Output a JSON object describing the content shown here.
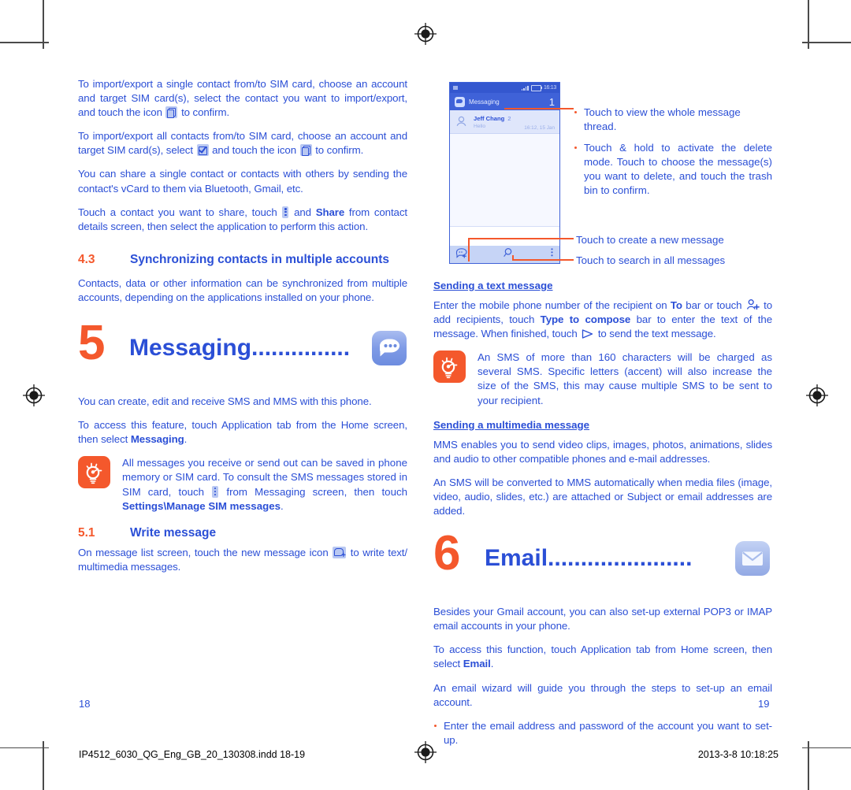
{
  "document": {
    "left_page_number": "18",
    "right_page_number": "19",
    "footer_file": "IP4512_6030_QG_Eng_GB_20_130308.indd   18-19",
    "footer_timestamp": "2013-3-8   10:18:25"
  },
  "left_column": {
    "paragraphs": [
      {
        "id": "p1",
        "pre": "To import/export a single contact from/to SIM card, choose an account and target SIM card(s), select the contact you want to import/export, and touch the icon ",
        "icon": "copy-icon",
        "post": " to confirm."
      },
      {
        "id": "p2",
        "pre": "To import/export all contacts from/to SIM card, choose an account and target SIM card(s), select ",
        "icon": "select-all-checkbox-icon",
        "mid": " and touch the icon ",
        "icon2": "copy-icon",
        "post": " to confirm."
      },
      {
        "id": "p3",
        "text": "You can share a single contact or contacts with others by sending the contact's vCard to them via Bluetooth, Gmail, etc."
      },
      {
        "id": "p4",
        "pre": "Touch a contact you want to share, touch ",
        "icon": "overflow-menu-icon",
        "mid": " and ",
        "bold": "Share",
        "post": " from contact details screen, then select the application to perform this action."
      }
    ],
    "section_4_3": {
      "number": "4.3",
      "title": "Synchronizing contacts in multiple accounts",
      "body": "Contacts, data or other information can be synchronized from multiple accounts, depending on the applications installed on your phone."
    },
    "chapter_5": {
      "number": "5",
      "title": "Messaging",
      "dots": "...............",
      "icon": "messaging-app-icon"
    },
    "messaging_intro": [
      "You can create, edit and receive SMS and MMS with this phone."
    ],
    "messaging_access": {
      "pre": "To access this feature, touch Application tab from the Home screen, then select ",
      "bold": "Messaging",
      "post": "."
    },
    "tip_note": {
      "icon": "tip-bulb-icon",
      "pre": "All messages you receive or send out can be saved in phone memory or SIM card. To consult the SMS messages stored in SIM card, touch ",
      "icon_inline": "overflow-menu-icon",
      "mid": " from Messaging screen, then touch ",
      "bold": "Settings\\Manage SIM messages",
      "post": "."
    },
    "section_5_1": {
      "number": "5.1",
      "title": "Write message",
      "pre": "On message list screen, touch the new message icon ",
      "icon": "new-message-icon",
      "post": " to write text/ multimedia messages."
    }
  },
  "phone_mock": {
    "status_bar": {
      "signal_icon": "signal-bars-icon",
      "battery_icon": "battery-icon",
      "clock": "16:13"
    },
    "app_bar": {
      "app_icon": "messaging-app-icon",
      "title": "Messaging",
      "count": "1"
    },
    "thread": {
      "avatar_icon": "contact-avatar-icon",
      "name": "Jeff Chang",
      "unread_count": "2",
      "preview": "Hello",
      "timestamp": "16:12, 15 Jan"
    },
    "bottom_bar": {
      "new_message_icon": "new-message-icon",
      "search_icon": "search-icon",
      "overflow_icon": "overflow-menu-icon"
    }
  },
  "callouts": {
    "thread_bullets": [
      "Touch to view the whole message thread.",
      "Touch & hold to activate the delete mode. Touch to choose the message(s) you want to delete, and touch the trash bin to confirm."
    ],
    "new_message": "Touch to create a new message",
    "search": "Touch to search in all messages"
  },
  "right_column": {
    "sending_text": {
      "heading": "Sending a text message",
      "pre": "Enter the mobile phone number of the recipient on ",
      "bold1": "To",
      "mid1": " bar or touch ",
      "icon1": "add-recipient-icon",
      "mid2": " to add recipients, touch ",
      "bold2": "Type to compose",
      "mid3": " bar to enter the text of the message. When finished, touch ",
      "icon2": "send-icon",
      "post": " to send the text message."
    },
    "tip_note": {
      "icon": "tip-bulb-icon",
      "text": "An SMS of more than 160 characters will be charged as several SMS. Specific letters (accent) will also increase the size of the SMS, this may cause multiple SMS to be sent to your recipient."
    },
    "sending_mms": {
      "heading": "Sending a multimedia message",
      "paragraphs": [
        "MMS enables you to send video clips, images, photos, animations, slides and audio to other compatible phones and e-mail addresses.",
        "An SMS will be converted to MMS automatically when media files (image, video, audio, slides, etc.) are attached or Subject or email addresses are added."
      ]
    },
    "chapter_6": {
      "number": "6",
      "title": "Email",
      "dots": "......................",
      "icon": "email-app-icon"
    },
    "email_body": {
      "p1": "Besides your Gmail account, you can also set-up external POP3 or IMAP email accounts in your phone.",
      "p2_pre": "To access this function, touch Application tab from Home screen, then select ",
      "p2_bold": "Email",
      "p2_post": ".",
      "p3": "An email wizard will guide you through the steps to set-up an email account.",
      "bullet1": "Enter the email address and password of the account you want to set-up."
    }
  },
  "colors": {
    "text_blue": "#2b4fd6",
    "accent_orange": "#f4582c",
    "phone_header": "#3f62d8",
    "icon_blue": "#b9c8f2"
  }
}
